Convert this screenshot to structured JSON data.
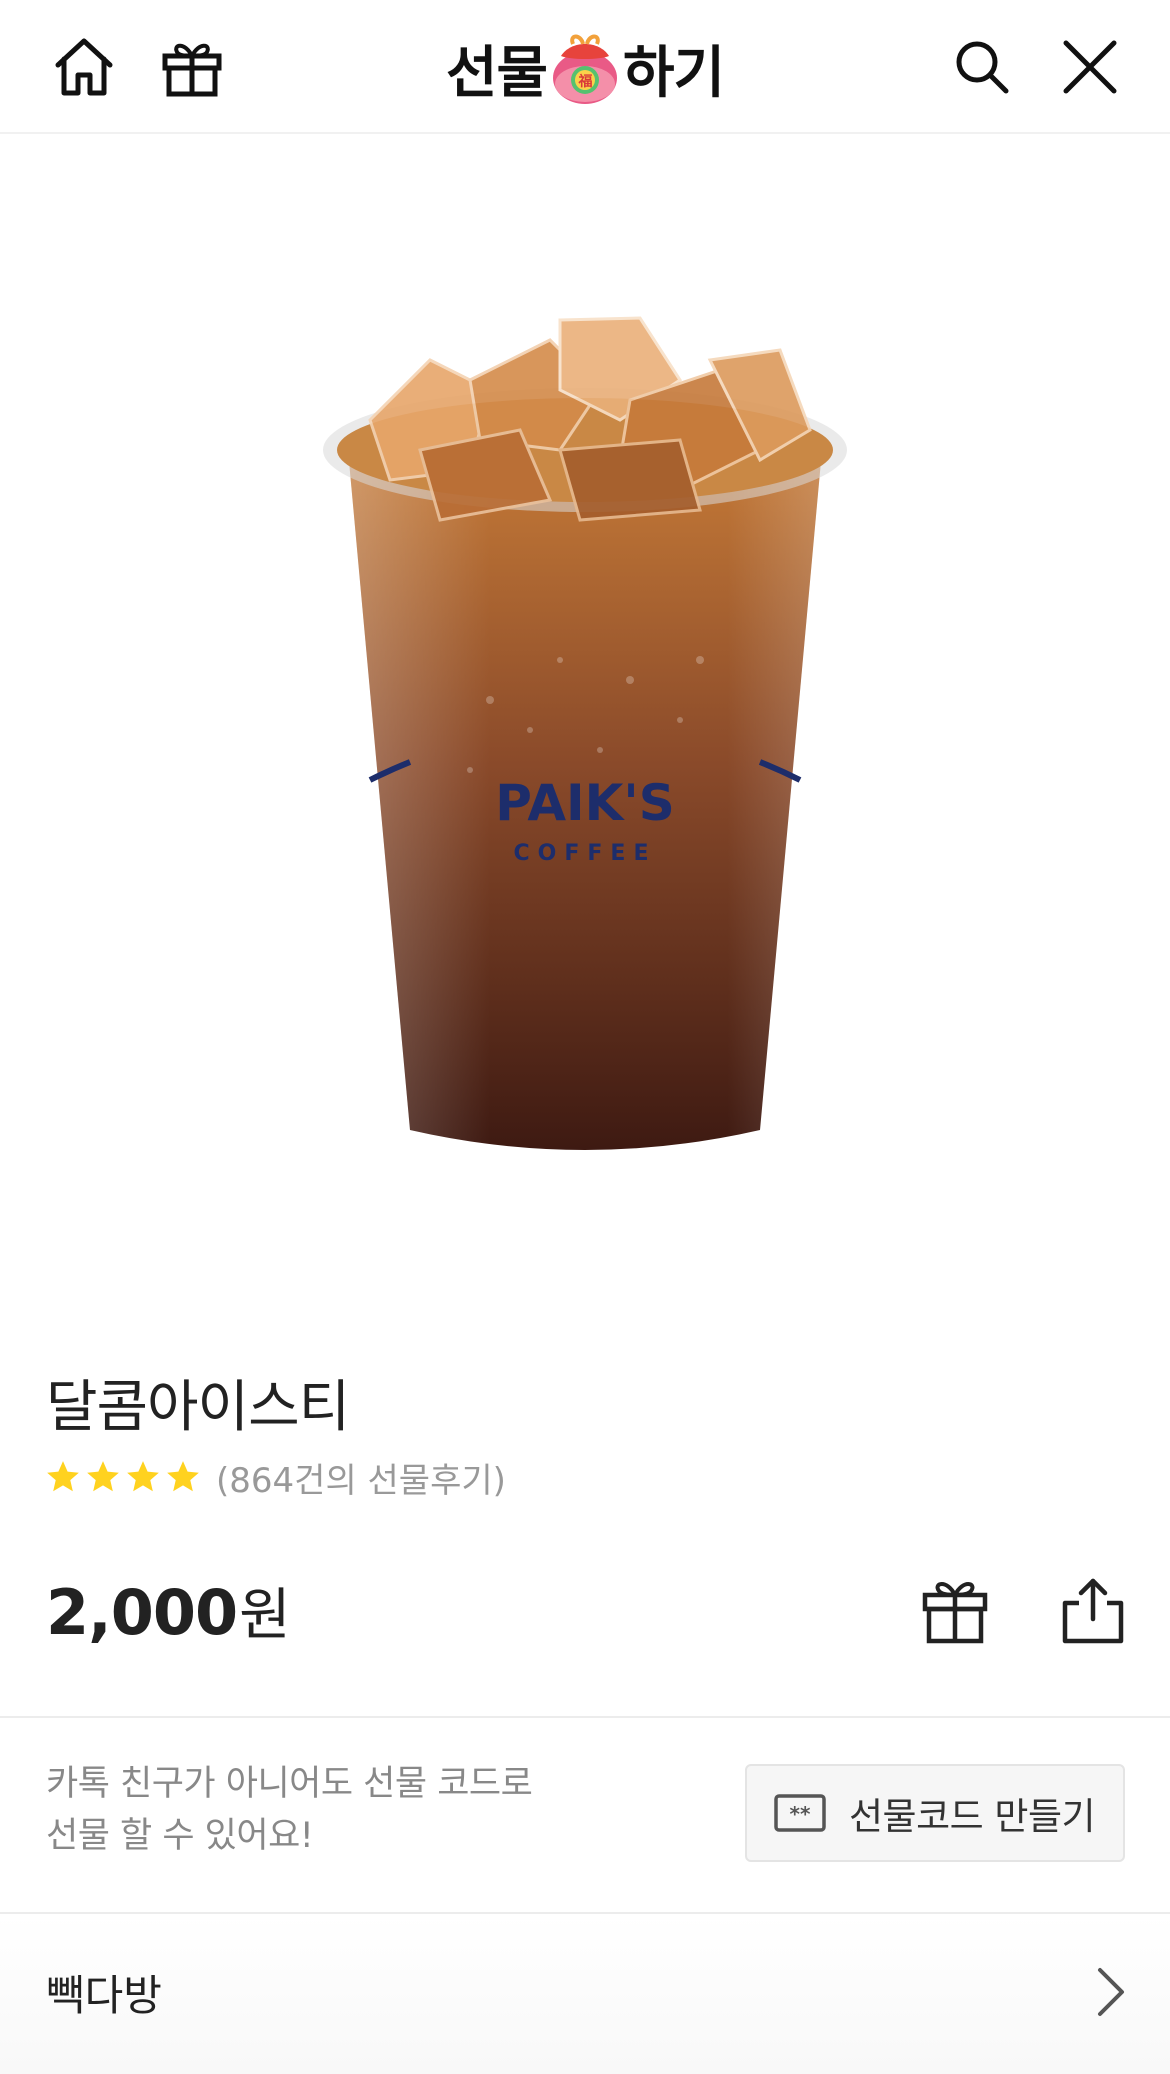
{
  "header": {
    "title_left": "선물",
    "title_right": "하기",
    "home_icon": "home-icon",
    "gift_box_icon": "gift-box-icon",
    "search_icon": "search-icon",
    "close_icon": "close-icon"
  },
  "product": {
    "image_label": "PAIK'S",
    "image_sublabel": "COFFEE",
    "name": "달콤아이스티",
    "rating_stars": 4,
    "review_text": "(864건의 선물후기)",
    "price_number": "2,000",
    "price_unit": "원"
  },
  "actions": {
    "gift_icon": "gift-icon",
    "share_icon": "share-icon"
  },
  "promo": {
    "line1": "카톡 친구가 아니어도 선물 코드로",
    "line2": "선물 할 수 있어요!",
    "button_label": "선물코드 만들기",
    "button_icon": "gift-code-icon"
  },
  "brand": {
    "name": "빽다방",
    "arrow_icon": "chevron-right-icon"
  },
  "colors": {
    "star": "#ffd21f",
    "logo_text": "#1d2d6b",
    "drink_top": "#b8692b",
    "drink_bottom": "#3e1a12"
  }
}
